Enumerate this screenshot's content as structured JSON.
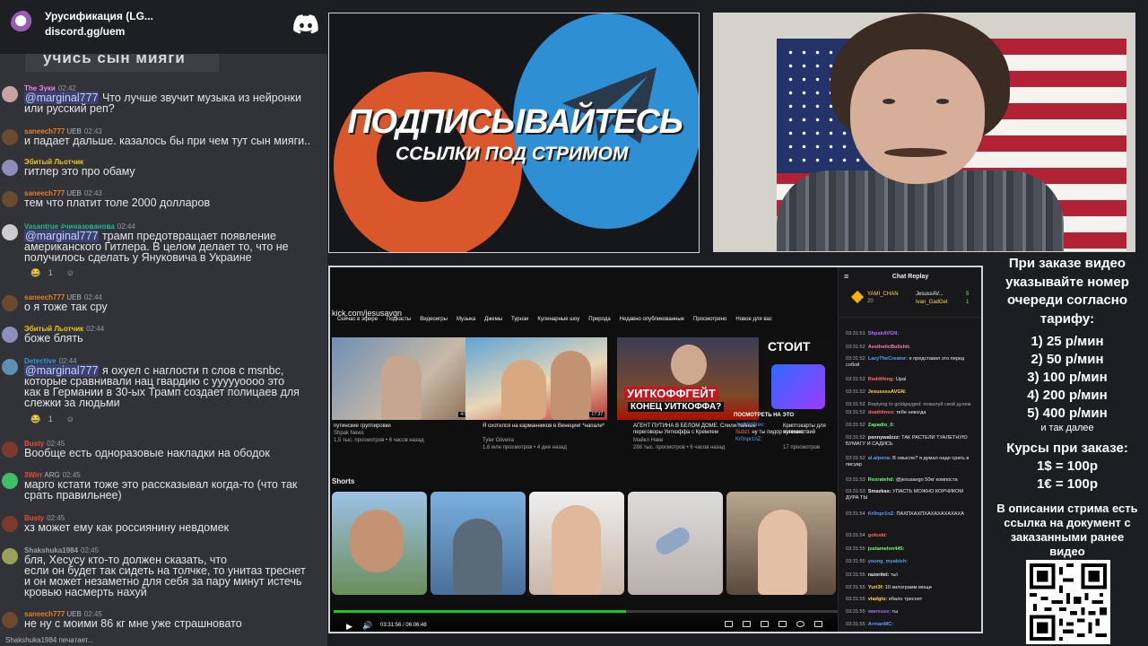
{
  "discord": {
    "server_name": "Урусификация (LG...",
    "invite": "discord.gg/uem",
    "banner_text": "учись сын мияги",
    "typing": "Shakshuka1984 печатает...",
    "messages": [
      {
        "name": "The Зуки",
        "color": "#f47fff",
        "time": "02:42",
        "badges": "",
        "text_mention": "@marginal777",
        "text": " Что лучше звучит музыка из нейронки\nили русский реп?"
      },
      {
        "name": "saneech777",
        "color": "#e67e22",
        "time": "02:43",
        "badges": "UEB",
        "text_mention": "",
        "text": "и падает дальше. казалось бы при чем тут сын мияги.."
      },
      {
        "name": "Эбитый Льотчик",
        "color": "#f1c40f",
        "time": "",
        "badges": "",
        "text_mention": "",
        "text": "гитлер это про обаму"
      },
      {
        "name": "saneech777",
        "color": "#e67e22",
        "time": "02:43",
        "badges": "UEB",
        "text_mention": "",
        "text": "тем что платит толе 2000 долларов"
      },
      {
        "name": "Vasantrue #чиназованова",
        "color": "#1abc9c",
        "time": "02:44",
        "badges": "",
        "text_mention": "@marginal777",
        "text": " трамп предотвращает появление\nамериканского Гитлера. В целом делает то, что не\nполучилось сделать у Януковича в Украине"
      },
      {
        "name": "saneech777",
        "color": "#e67e22",
        "time": "02:44",
        "badges": "UEB",
        "text_mention": "",
        "text": "о я тоже так сру"
      },
      {
        "name": "Эбитый Льотчик",
        "color": "#f1c40f",
        "time": "02:44",
        "badges": "",
        "text_mention": "",
        "text": "боже блять"
      },
      {
        "name": "Detective",
        "color": "#3498db",
        "time": "02:44",
        "badges": "",
        "text_mention": "@marginal777",
        "text": " я охуел с наглости п слов с msnbc,\nкоторые сравнивали нац гвардию с уууууоооо это\nкак в Германии в 30-ых Трамп создает полицаев для\nслежки за людьми"
      },
      {
        "name": "Busty",
        "color": "#e74c3c",
        "time": "02:45",
        "badges": "",
        "text_mention": "",
        "text": "Вообще есть одноразовые накладки на ободок"
      },
      {
        "name": "3Wirr",
        "color": "#e74c3c",
        "time": "02:45",
        "badges": "ARG",
        "text_mention": "",
        "text": "марго кстати тоже это рассказывал когда-то (что так\nсрать правильнее)"
      },
      {
        "name": "Busty",
        "color": "#e74c3c",
        "time": "02:45",
        "badges": "",
        "text_mention": "",
        "text": "хз может ему как россиянину невдомек"
      },
      {
        "name": "Shakshuka1984",
        "color": "#95a5a6",
        "time": "02:45",
        "badges": "",
        "text_mention": "",
        "text": "бля, Хесусу кто-то должен сказать, что\nесли он будет так сидеть на толчке, то унитаз треснет\nи он может незаметно для себя за пару минут истечь\nкровью насмерть нахуй"
      },
      {
        "name": "saneech777",
        "color": "#e67e22",
        "time": "02:45",
        "badges": "UEB",
        "text_mention": "",
        "text": "не ну с моими 86 кг мне уже страшновато"
      }
    ],
    "reactions": [
      {
        "emoji": "😂",
        "count": "1"
      },
      {
        "emoji": "😂",
        "count": "1"
      }
    ]
  },
  "promo": {
    "title": "ПОДПИСЫВАЙТЕСЬ",
    "subtitle": "ССЫЛКИ ПОД СТРИМОМ"
  },
  "youtube": {
    "url": "kick.com/jesusavgn",
    "chips": [
      "Сейчас в эфире",
      "Подкасты",
      "Видеоигры",
      "Музыка",
      "Джемы",
      "Турнэи",
      "Кулинарные шоу",
      "Природа",
      "Недавно опубликованные",
      "Просмотрено",
      "Новое для вас"
    ],
    "videos": [
      {
        "title": "путинские группировки",
        "channel": "Shpak News",
        "meta": "1,5 тыс. просмотров • 6 часов назад",
        "duration": "4:05"
      },
      {
        "title": "Я охотился на карманников в Венеции! *напали*",
        "channel": "Tyler Oliveira",
        "meta": "1,6 млн просмотров • 4 дня назад",
        "duration": "17:37"
      },
      {
        "title": "АГЕНТ ПУТИНА В БЕЛОМ ДОМЕ. Слили тайные переговоры Уиткоффа с Кремлем",
        "channel": "Майкл Наки",
        "meta": "288 тыс. просмотров • 6 часов назад",
        "duration": ""
      },
      {
        "title": "Криптокарты для путешествий",
        "channel": "",
        "meta": "17 просмотров",
        "duration": ""
      }
    ],
    "thumb3_text1": "УИТКОФФГЕЙТ",
    "thumb3_text2": "КОНЕЦ УИТКОФФА?",
    "thumb4_text": "СТОИТ",
    "overlay_watch": "ПОСМОТРЕТЬ НА ЭТО",
    "shorts_label": "Shorts",
    "time": "03:31:56 / 06:06:48",
    "progress": 0.58
  },
  "replay": {
    "title": "Chat Replay",
    "top_users": [
      {
        "name": "YAMI_CHAN",
        "value": "20"
      },
      {
        "name": "JesussAV...",
        "value": "5"
      },
      {
        "name": "Ivan_GadGet",
        "value": "1"
      }
    ],
    "lines": [
      {
        "t": "03:31:51",
        "user": "ShpakAVGN:",
        "color": "#a970ff",
        "text": ""
      },
      {
        "t": "03:31:52",
        "user": "AestheticBullshit:",
        "color": "#ff7fa0",
        "text": ""
      },
      {
        "t": "03:31:52",
        "user": "LazyTheCreator:",
        "color": "#5c9cff",
        "text": "я представил это перед собой"
      },
      {
        "t": "03:31:52",
        "user": "Reddthing:",
        "color": "#ff6b6b",
        "text": "Upal"
      },
      {
        "t": "03:31:52",
        "user": "JesussssAVGN:",
        "color": "#ffd54f",
        "text": ""
      },
      {
        "t": "03:31:52",
        "user": "Replying to goldgayged:",
        "color": "#adadb8",
        "text": "пожалуй свой духем"
      },
      {
        "t": "03:31:52",
        "user": "deathlineo:",
        "color": "#ff6b6b",
        "text": "тебе никогда"
      },
      {
        "t": "03:31:52",
        "user": "Zapadlo_0:",
        "color": "#6bff6b",
        "text": ""
      },
      {
        "t": "03:31:52",
        "user": "pennywalzzz:",
        "color": "#efeff1",
        "text": "ТАК РАСТЕЛИ ТУАЛЕТНУЮ БУМАГУ И САДИСЬ"
      },
      {
        "t": "03:31:52",
        "user": "al.alpena:",
        "color": "#5c9cff",
        "text": "В смысле? я думал надо срать в писуар"
      },
      {
        "t": "03:31:53",
        "user": "Roxratehd:",
        "color": "#6bff6b",
        "text": "@jesusavgn 50кг компоста"
      },
      {
        "t": "03:31:53",
        "user": "Smazkas:",
        "color": "#efeff1",
        "text": "УПАСТЬ МОЖНО КОРЧИКОМ ДУРА ТЫ"
      },
      {
        "t": "03:31:54",
        "user": "Kr0npr1nZ:",
        "color": "#5c9cff",
        "text": "ПАХПХАХПХАХАХАХАХАХА"
      },
      {
        "t": "03:31:54",
        "user": "goloski:",
        "color": "#ff6b6b",
        "text": ""
      },
      {
        "t": "03:31:55",
        "user": "justamelon445:",
        "color": "#6bff6b",
        "text": ""
      },
      {
        "t": "03:31:55",
        "user": "young_myakish:",
        "color": "#5c9cff",
        "text": ""
      },
      {
        "t": "03:31:55",
        "user": "razoritel:",
        "color": "#efeff1",
        "text": "ты\\"
      },
      {
        "t": "03:31:55",
        "user": "Yuri3f:",
        "color": "#ffd54f",
        "text": "10 килограмм мощи"
      },
      {
        "t": "03:31:55",
        "user": "vladgtx:",
        "color": "#ffd54f",
        "text": "ебало треснет"
      },
      {
        "t": "03:31:55",
        "user": "wwrxsss:",
        "color": "#a970ff",
        "text": "ты"
      },
      {
        "t": "03:31:55",
        "user": "ArmanMC:",
        "color": "#5c9cff",
        "text": ""
      }
    ],
    "overlay_lines": [
      {
        "user": "JackStOrev:",
        "text": "свобода, который дал"
      },
      {
        "user": "Subzi:",
        "text": "ну ты пидор конечно"
      },
      {
        "user": "Kr0npr1nZ:",
        "text": ""
      }
    ]
  },
  "info": {
    "order_text": "При заказе видео указывайте номер очереди согласно тарифу:",
    "tariffs": [
      "1) 25 р/мин",
      "2) 50 р/мин",
      "3) 100 р/мин",
      "4) 200 р/мин",
      "5) 400 р/мин"
    ],
    "and_more": "и так далее",
    "rates_title": "Курсы при заказе:",
    "rate_usd": "1$ = 100р",
    "rate_eur": "1€ = 100р",
    "doc_text": "В описании стрима есть ссылка на документ с заказанными ранее видео"
  }
}
